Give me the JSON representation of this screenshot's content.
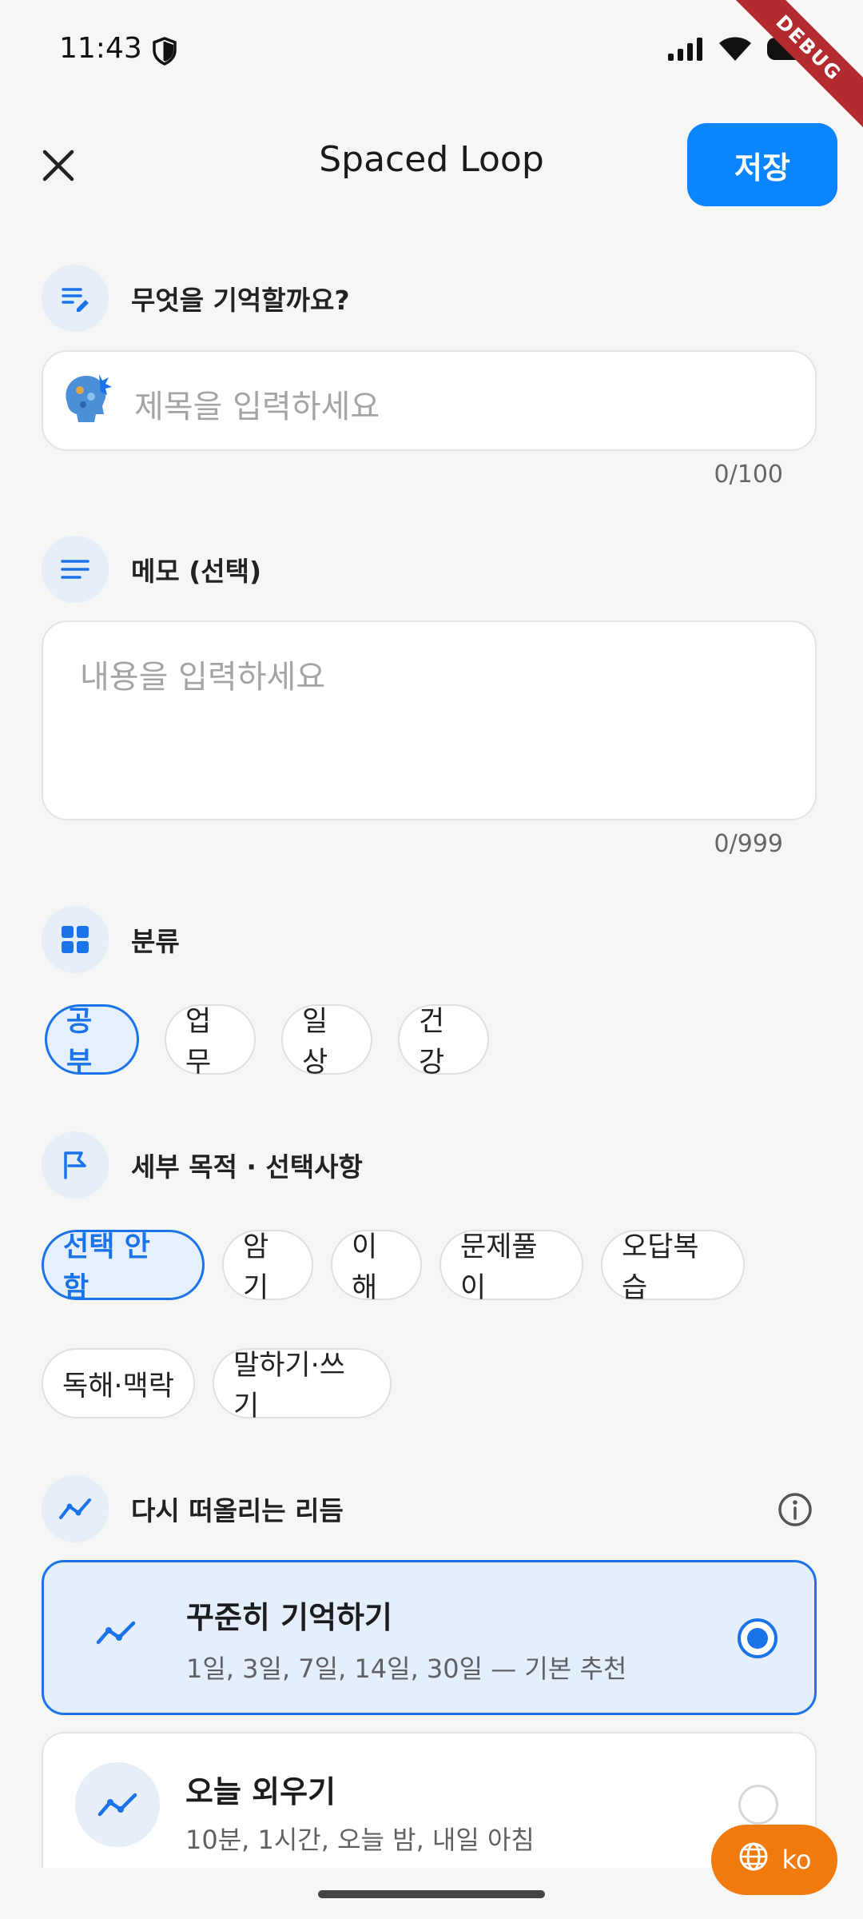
{
  "status_bar": {
    "time": "11:43",
    "debug_banner": "DEBUG"
  },
  "app_bar": {
    "title": "Spaced Loop",
    "save_label": "저장"
  },
  "title_section": {
    "label": "무엇을 기억할까요?",
    "placeholder": "제목을 입력하세요",
    "counter": "0/100"
  },
  "memo_section": {
    "label": "메모 (선택)",
    "placeholder": "내용을 입력하세요",
    "counter": "0/999"
  },
  "category_section": {
    "label": "분류",
    "chips": [
      "공부",
      "업무",
      "일상",
      "건강"
    ],
    "selected": "공부"
  },
  "purpose_section": {
    "label": "세부 목적 · 선택사항",
    "chips_row1": [
      "선택 안 함",
      "암기",
      "이해",
      "문제풀이",
      "오답복습"
    ],
    "chips_row2": [
      "독해·맥락",
      "말하기·쓰기"
    ],
    "selected": "선택 안 함"
  },
  "rhythm_section": {
    "label": "다시 떠올리는 리듬",
    "options": [
      {
        "title": "꾸준히 기억하기",
        "subtitle": "1일, 3일, 7일, 14일, 30일 — 기본 추천",
        "selected": true
      },
      {
        "title": "오늘 외우기",
        "subtitle": "10분, 1시간, 오늘 밤, 내일 아침",
        "selected": false
      }
    ]
  },
  "language_button": {
    "label": "ko"
  },
  "colors": {
    "accent": "#0a84ff",
    "selected_chip": "#1a73e8",
    "language_button": "#f07a0b",
    "background": "#f6f6f5"
  }
}
